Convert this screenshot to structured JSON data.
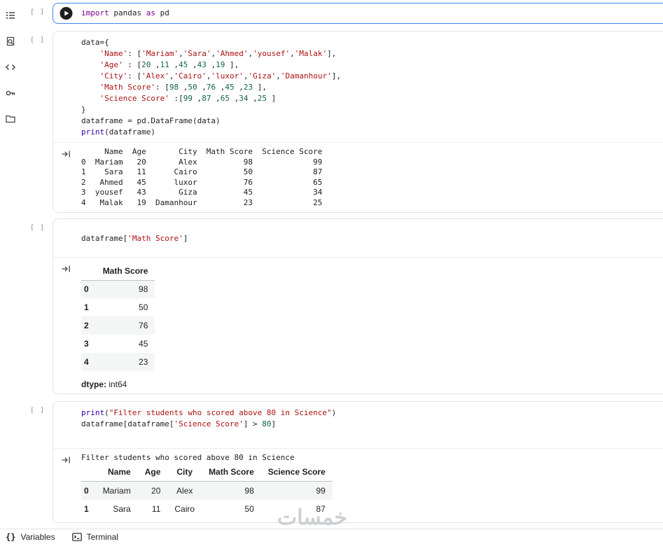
{
  "colors": {
    "keyword": "#770088",
    "string": "#aa1111",
    "number": "#116644",
    "builtin": "#3300aa",
    "code_text": "#212121",
    "focus_border": "#4285f4",
    "row_stripe": "#f4f5f5"
  },
  "sidebar": {
    "items": [
      {
        "name": "toc",
        "icon": "toc-icon"
      },
      {
        "name": "search",
        "icon": "search-doc-icon"
      },
      {
        "name": "code-snippets",
        "icon": "code-icon"
      },
      {
        "name": "secrets",
        "icon": "key-icon"
      },
      {
        "name": "files",
        "icon": "folder-icon"
      }
    ]
  },
  "cells": [
    {
      "prompt": "[ ]",
      "focused": true,
      "has_play": true,
      "code": [
        [
          [
            "k",
            "import"
          ],
          [
            "p",
            " pandas "
          ],
          [
            "k",
            "as"
          ],
          [
            "p",
            " pd"
          ]
        ]
      ]
    },
    {
      "prompt": "[ ]",
      "code": [
        [
          [
            "p",
            "data={"
          ]
        ],
        [
          [
            "p",
            "    "
          ],
          [
            "s",
            "'Name'"
          ],
          [
            "p",
            ": ["
          ],
          [
            "s",
            "'Mariam'"
          ],
          [
            "p",
            ","
          ],
          [
            "s",
            "'Sara'"
          ],
          [
            "p",
            ","
          ],
          [
            "s",
            "'Ahmed'"
          ],
          [
            "p",
            ","
          ],
          [
            "s",
            "'yousef'"
          ],
          [
            "p",
            ","
          ],
          [
            "s",
            "'Malak'"
          ],
          [
            "p",
            "],"
          ]
        ],
        [
          [
            "p",
            "    "
          ],
          [
            "s",
            "'Age'"
          ],
          [
            "p",
            " : ["
          ],
          [
            "n",
            "20"
          ],
          [
            "p",
            " ,"
          ],
          [
            "n",
            "11"
          ],
          [
            "p",
            " ,"
          ],
          [
            "n",
            "45"
          ],
          [
            "p",
            " ,"
          ],
          [
            "n",
            "43"
          ],
          [
            "p",
            " ,"
          ],
          [
            "n",
            "19"
          ],
          [
            "p",
            " ],"
          ]
        ],
        [
          [
            "p",
            "    "
          ],
          [
            "s",
            "'City'"
          ],
          [
            "p",
            ": ["
          ],
          [
            "s",
            "'Alex'"
          ],
          [
            "p",
            ","
          ],
          [
            "s",
            "'Cairo'"
          ],
          [
            "p",
            ","
          ],
          [
            "s",
            "'luxor'"
          ],
          [
            "p",
            ","
          ],
          [
            "s",
            "'Giza'"
          ],
          [
            "p",
            ","
          ],
          [
            "s",
            "'Damanhour'"
          ],
          [
            "p",
            "],"
          ]
        ],
        [
          [
            "p",
            "    "
          ],
          [
            "s",
            "'Math Score'"
          ],
          [
            "p",
            ": ["
          ],
          [
            "n",
            "98"
          ],
          [
            "p",
            " ,"
          ],
          [
            "n",
            "50"
          ],
          [
            "p",
            " ,"
          ],
          [
            "n",
            "76"
          ],
          [
            "p",
            " ,"
          ],
          [
            "n",
            "45"
          ],
          [
            "p",
            " ,"
          ],
          [
            "n",
            "23"
          ],
          [
            "p",
            " ],"
          ]
        ],
        [
          [
            "p",
            "    "
          ],
          [
            "s",
            "'Science Score'"
          ],
          [
            "p",
            " :["
          ],
          [
            "n",
            "99"
          ],
          [
            "p",
            " ,"
          ],
          [
            "n",
            "87"
          ],
          [
            "p",
            " ,"
          ],
          [
            "n",
            "65"
          ],
          [
            "p",
            " ,"
          ],
          [
            "n",
            "34"
          ],
          [
            "p",
            " ,"
          ],
          [
            "n",
            "25"
          ],
          [
            "p",
            " ]"
          ]
        ],
        [
          [
            "p",
            "}"
          ]
        ],
        [
          [
            "p",
            "dataframe = pd.DataFrame(data)"
          ]
        ],
        [
          [
            "b",
            "print"
          ],
          [
            "p",
            "(dataframe)"
          ]
        ]
      ],
      "outputs": [
        {
          "kind": "text",
          "lines": [
            "     Name  Age       City  Math Score  Science Score",
            "0  Mariam   20       Alex          98             99",
            "1    Sara   11      Cairo          50             87",
            "2   Ahmed   45      luxor          76             65",
            "3  yousef   43       Giza          45             34",
            "4   Malak   19  Damanhour          23             25"
          ]
        }
      ]
    },
    {
      "prompt": "[ ]",
      "code": [
        [
          [
            "p",
            "dataframe["
          ],
          [
            "s",
            "'Math Score'"
          ],
          [
            "p",
            "]"
          ]
        ]
      ],
      "outputs": [
        {
          "kind": "series",
          "value_header": "Math Score",
          "rows": [
            [
              "0",
              "98"
            ],
            [
              "1",
              "50"
            ],
            [
              "2",
              "76"
            ],
            [
              "3",
              "45"
            ],
            [
              "4",
              "23"
            ]
          ],
          "dtype_label": "dtype:",
          "dtype_value": "int64"
        }
      ]
    },
    {
      "prompt": "[ ]",
      "code": [
        [
          [
            "b",
            "print"
          ],
          [
            "p",
            "("
          ],
          [
            "s",
            "\"Filter students who scored above 80 in Science\""
          ],
          [
            "p",
            ")"
          ]
        ],
        [
          [
            "p",
            "dataframe[dataframe["
          ],
          [
            "s",
            "'Science Score'"
          ],
          [
            "p",
            "] > "
          ],
          [
            "n",
            "80"
          ],
          [
            "p",
            "]"
          ]
        ]
      ],
      "outputs": [
        {
          "kind": "text",
          "lines": [
            "Filter students who scored above 80 in Science"
          ]
        },
        {
          "kind": "dataframe",
          "columns": [
            "Name",
            "Age",
            "City",
            "Math Score",
            "Science Score"
          ],
          "col_aligns": [
            "right",
            "right",
            "center",
            "right",
            "right"
          ],
          "rows": [
            [
              "0",
              "Mariam",
              "20",
              "Alex",
              "98",
              "99"
            ],
            [
              "1",
              "Sara",
              "11",
              "Cairo",
              "50",
              "87"
            ]
          ]
        }
      ]
    }
  ],
  "footer": {
    "braces_glyph": "{}",
    "variables_label": "Variables",
    "terminal_label": "Terminal"
  },
  "watermark": "خمسات"
}
